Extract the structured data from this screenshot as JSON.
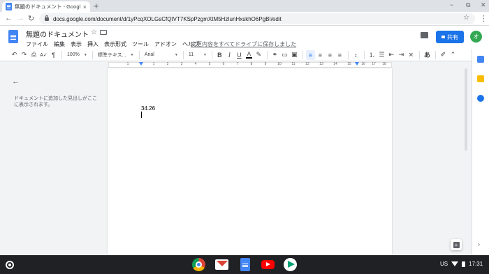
{
  "browser": {
    "tab_title": "無題のドキュメント - Google",
    "tab_close": "×",
    "new_tab": "+",
    "window_controls": [
      "−",
      "⧉",
      "✕"
    ],
    "url": "docs.google.com/document/d/1yPcqXOLGsCfQtVT7KSpPzgmXtM5HzIunHxskhO6PgBI/edit"
  },
  "docs": {
    "title": "無題のドキュメント",
    "menu": [
      "ファイル",
      "編集",
      "表示",
      "挿入",
      "表示形式",
      "ツール",
      "アドオン",
      "ヘルプ"
    ],
    "saved_status": "変更内容をすべてドライブに保存しました",
    "share_label": "共有",
    "avatar_initial": "オ"
  },
  "toolbar": {
    "zoom": "100%",
    "style": "標準テキス...",
    "font": "Arial",
    "font_size": "11",
    "input_tool": "あ"
  },
  "ruler": {
    "labels": [
      "1",
      "1",
      "2",
      "3",
      "4",
      "5",
      "6",
      "7",
      "8",
      "9",
      "10",
      "11",
      "12",
      "13",
      "14",
      "15",
      "16",
      "17",
      "18"
    ]
  },
  "outline": {
    "hint": "ドキュメントに追加した見出しがここに表示されます。"
  },
  "document": {
    "body_text": "34.26"
  },
  "shelf": {
    "locale": "US",
    "time": "17:31"
  }
}
